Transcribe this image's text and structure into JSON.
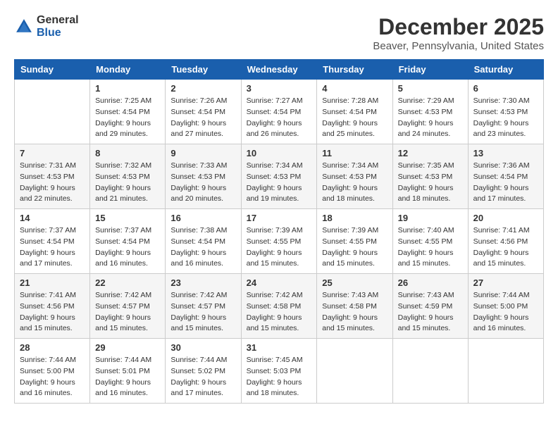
{
  "logo": {
    "general": "General",
    "blue": "Blue"
  },
  "header": {
    "month": "December 2025",
    "location": "Beaver, Pennsylvania, United States"
  },
  "weekdays": [
    "Sunday",
    "Monday",
    "Tuesday",
    "Wednesday",
    "Thursday",
    "Friday",
    "Saturday"
  ],
  "weeks": [
    [
      {
        "day": "",
        "sunrise": "",
        "sunset": "",
        "daylight": ""
      },
      {
        "day": "1",
        "sunrise": "Sunrise: 7:25 AM",
        "sunset": "Sunset: 4:54 PM",
        "daylight": "Daylight: 9 hours and 29 minutes."
      },
      {
        "day": "2",
        "sunrise": "Sunrise: 7:26 AM",
        "sunset": "Sunset: 4:54 PM",
        "daylight": "Daylight: 9 hours and 27 minutes."
      },
      {
        "day": "3",
        "sunrise": "Sunrise: 7:27 AM",
        "sunset": "Sunset: 4:54 PM",
        "daylight": "Daylight: 9 hours and 26 minutes."
      },
      {
        "day": "4",
        "sunrise": "Sunrise: 7:28 AM",
        "sunset": "Sunset: 4:54 PM",
        "daylight": "Daylight: 9 hours and 25 minutes."
      },
      {
        "day": "5",
        "sunrise": "Sunrise: 7:29 AM",
        "sunset": "Sunset: 4:53 PM",
        "daylight": "Daylight: 9 hours and 24 minutes."
      },
      {
        "day": "6",
        "sunrise": "Sunrise: 7:30 AM",
        "sunset": "Sunset: 4:53 PM",
        "daylight": "Daylight: 9 hours and 23 minutes."
      }
    ],
    [
      {
        "day": "7",
        "sunrise": "Sunrise: 7:31 AM",
        "sunset": "Sunset: 4:53 PM",
        "daylight": "Daylight: 9 hours and 22 minutes."
      },
      {
        "day": "8",
        "sunrise": "Sunrise: 7:32 AM",
        "sunset": "Sunset: 4:53 PM",
        "daylight": "Daylight: 9 hours and 21 minutes."
      },
      {
        "day": "9",
        "sunrise": "Sunrise: 7:33 AM",
        "sunset": "Sunset: 4:53 PM",
        "daylight": "Daylight: 9 hours and 20 minutes."
      },
      {
        "day": "10",
        "sunrise": "Sunrise: 7:34 AM",
        "sunset": "Sunset: 4:53 PM",
        "daylight": "Daylight: 9 hours and 19 minutes."
      },
      {
        "day": "11",
        "sunrise": "Sunrise: 7:34 AM",
        "sunset": "Sunset: 4:53 PM",
        "daylight": "Daylight: 9 hours and 18 minutes."
      },
      {
        "day": "12",
        "sunrise": "Sunrise: 7:35 AM",
        "sunset": "Sunset: 4:53 PM",
        "daylight": "Daylight: 9 hours and 18 minutes."
      },
      {
        "day": "13",
        "sunrise": "Sunrise: 7:36 AM",
        "sunset": "Sunset: 4:54 PM",
        "daylight": "Daylight: 9 hours and 17 minutes."
      }
    ],
    [
      {
        "day": "14",
        "sunrise": "Sunrise: 7:37 AM",
        "sunset": "Sunset: 4:54 PM",
        "daylight": "Daylight: 9 hours and 17 minutes."
      },
      {
        "day": "15",
        "sunrise": "Sunrise: 7:37 AM",
        "sunset": "Sunset: 4:54 PM",
        "daylight": "Daylight: 9 hours and 16 minutes."
      },
      {
        "day": "16",
        "sunrise": "Sunrise: 7:38 AM",
        "sunset": "Sunset: 4:54 PM",
        "daylight": "Daylight: 9 hours and 16 minutes."
      },
      {
        "day": "17",
        "sunrise": "Sunrise: 7:39 AM",
        "sunset": "Sunset: 4:55 PM",
        "daylight": "Daylight: 9 hours and 15 minutes."
      },
      {
        "day": "18",
        "sunrise": "Sunrise: 7:39 AM",
        "sunset": "Sunset: 4:55 PM",
        "daylight": "Daylight: 9 hours and 15 minutes."
      },
      {
        "day": "19",
        "sunrise": "Sunrise: 7:40 AM",
        "sunset": "Sunset: 4:55 PM",
        "daylight": "Daylight: 9 hours and 15 minutes."
      },
      {
        "day": "20",
        "sunrise": "Sunrise: 7:41 AM",
        "sunset": "Sunset: 4:56 PM",
        "daylight": "Daylight: 9 hours and 15 minutes."
      }
    ],
    [
      {
        "day": "21",
        "sunrise": "Sunrise: 7:41 AM",
        "sunset": "Sunset: 4:56 PM",
        "daylight": "Daylight: 9 hours and 15 minutes."
      },
      {
        "day": "22",
        "sunrise": "Sunrise: 7:42 AM",
        "sunset": "Sunset: 4:57 PM",
        "daylight": "Daylight: 9 hours and 15 minutes."
      },
      {
        "day": "23",
        "sunrise": "Sunrise: 7:42 AM",
        "sunset": "Sunset: 4:57 PM",
        "daylight": "Daylight: 9 hours and 15 minutes."
      },
      {
        "day": "24",
        "sunrise": "Sunrise: 7:42 AM",
        "sunset": "Sunset: 4:58 PM",
        "daylight": "Daylight: 9 hours and 15 minutes."
      },
      {
        "day": "25",
        "sunrise": "Sunrise: 7:43 AM",
        "sunset": "Sunset: 4:58 PM",
        "daylight": "Daylight: 9 hours and 15 minutes."
      },
      {
        "day": "26",
        "sunrise": "Sunrise: 7:43 AM",
        "sunset": "Sunset: 4:59 PM",
        "daylight": "Daylight: 9 hours and 15 minutes."
      },
      {
        "day": "27",
        "sunrise": "Sunrise: 7:44 AM",
        "sunset": "Sunset: 5:00 PM",
        "daylight": "Daylight: 9 hours and 16 minutes."
      }
    ],
    [
      {
        "day": "28",
        "sunrise": "Sunrise: 7:44 AM",
        "sunset": "Sunset: 5:00 PM",
        "daylight": "Daylight: 9 hours and 16 minutes."
      },
      {
        "day": "29",
        "sunrise": "Sunrise: 7:44 AM",
        "sunset": "Sunset: 5:01 PM",
        "daylight": "Daylight: 9 hours and 16 minutes."
      },
      {
        "day": "30",
        "sunrise": "Sunrise: 7:44 AM",
        "sunset": "Sunset: 5:02 PM",
        "daylight": "Daylight: 9 hours and 17 minutes."
      },
      {
        "day": "31",
        "sunrise": "Sunrise: 7:45 AM",
        "sunset": "Sunset: 5:03 PM",
        "daylight": "Daylight: 9 hours and 18 minutes."
      },
      {
        "day": "",
        "sunrise": "",
        "sunset": "",
        "daylight": ""
      },
      {
        "day": "",
        "sunrise": "",
        "sunset": "",
        "daylight": ""
      },
      {
        "day": "",
        "sunrise": "",
        "sunset": "",
        "daylight": ""
      }
    ]
  ]
}
